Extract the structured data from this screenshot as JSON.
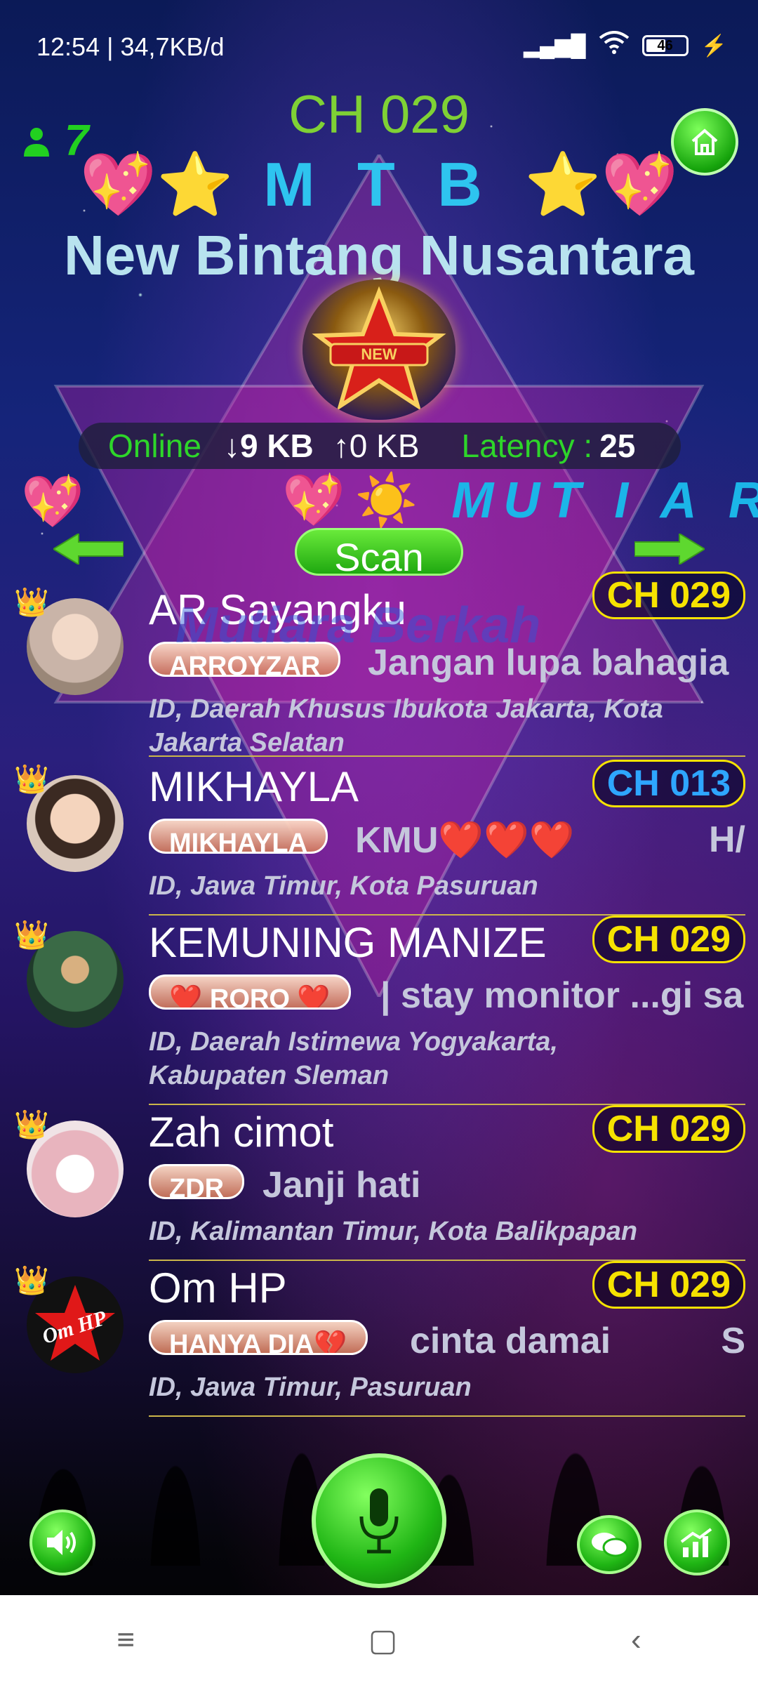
{
  "status_bar": {
    "time": "12:54 | 34,7KB/d",
    "battery": "46"
  },
  "header": {
    "user_count": "7",
    "channel": "CH 029",
    "tag_letters": "M T B",
    "group_name": "New Bintang Nusantara",
    "logo_text": "NEW"
  },
  "network": {
    "online_label": "Online",
    "download": "9 KB",
    "upload": "0 KB",
    "latency_label": "Latency :",
    "latency_value": "25"
  },
  "marquee_text": "MUT I A R A",
  "scan_label": "Scan",
  "watermark": "Mutiara Berkah",
  "users": [
    {
      "name": "AR Sayangku",
      "channel": "CH 029",
      "tag": "ARROYZAR",
      "message": "Jangan lupa bahagia",
      "tail": "",
      "location": "ID, Daerah Khusus Ibukota Jakarta, Kota Jakarta Selatan",
      "avatar_color": "#d9c2b4"
    },
    {
      "name": "MIKHAYLA",
      "channel": "CH 013",
      "tag": "MIKHAYLA",
      "message": "KMU❤️❤️❤️",
      "tail": "H/",
      "location": "ID, Jawa Timur, Kota Pasuruan",
      "avatar_color": "#e8c9b2"
    },
    {
      "name": "KEMUNING MANIZE",
      "channel": "CH 029",
      "tag": "❤️ RORO ❤️",
      "message": "| stay monitor ...gi sa",
      "tail": "",
      "location": "ID, Daerah Istimewa Yogyakarta, Kabupaten Sleman",
      "avatar_color": "#5f8e6b"
    },
    {
      "name": "Zah cimot",
      "channel": "CH 029",
      "tag": "ZDR",
      "message": "Janji hati",
      "tail": "",
      "location": "ID, Kalimantan Timur, Kota Balikpapan",
      "avatar_color": "#f0e3e6"
    },
    {
      "name": "Om HP",
      "channel": "CH 029",
      "tag": "HANYA DIA💔",
      "message": "cinta damai",
      "tail": "S",
      "location": "ID, Jawa Timur, Pasuruan",
      "avatar_color": "#111111"
    }
  ],
  "colors": {
    "accent_green": "#22d020",
    "channel_yellow": "#f6e200",
    "channel_blue": "#2ea6ff"
  }
}
